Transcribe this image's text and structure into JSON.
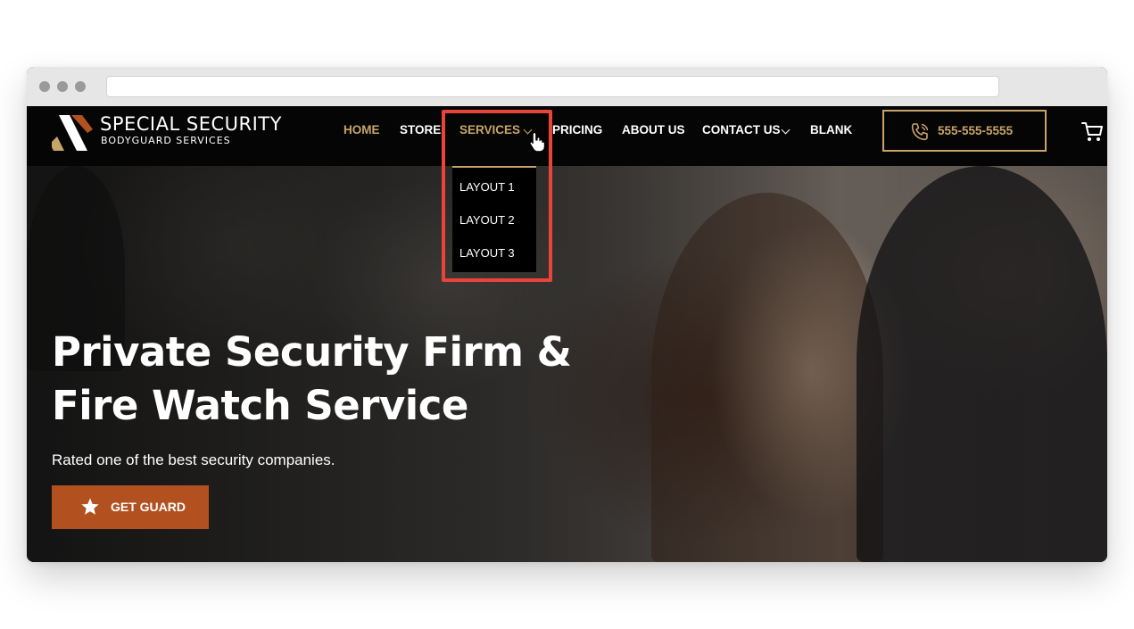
{
  "brand": {
    "title": "SPECIAL SECURITY",
    "subtitle": "BODYGUARD SERVICES"
  },
  "nav": {
    "items": [
      {
        "label": "HOME"
      },
      {
        "label": "STORE"
      },
      {
        "label": "SERVICES"
      },
      {
        "label": "PRICING"
      },
      {
        "label": "ABOUT US"
      },
      {
        "label": "CONTACT US"
      },
      {
        "label": "BLANK"
      }
    ],
    "active": "HOME",
    "open_menu": "SERVICES"
  },
  "services_menu": {
    "items": [
      {
        "label": "LAYOUT 1"
      },
      {
        "label": "LAYOUT 2"
      },
      {
        "label": "LAYOUT 3"
      }
    ]
  },
  "phone": {
    "label": "555-555-5555",
    "icon": "phone-icon"
  },
  "cart": {
    "icon": "cart-icon"
  },
  "hero": {
    "title": "Private Security Firm & Fire Watch Service",
    "subtitle": "Rated one of the best security companies.",
    "cta_label": "GET GUARD",
    "cta_icon": "star-icon"
  },
  "colors": {
    "gold": "#c9a46a",
    "cta": "#b2511f",
    "highlight": "#e8443a",
    "header_bg": "#050505"
  }
}
